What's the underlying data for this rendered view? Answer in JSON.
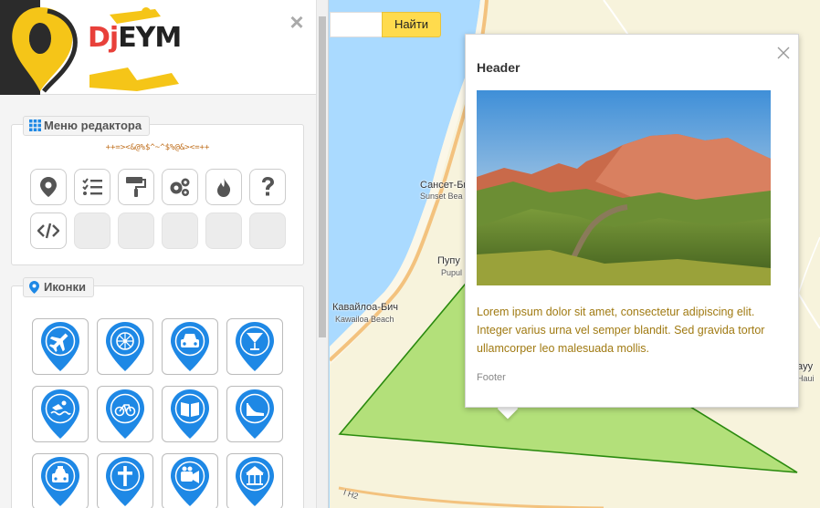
{
  "sidebar": {
    "close_label": "×",
    "logo": {
      "part1": "Dj",
      "part2": "EYM"
    },
    "editor_menu": {
      "title": "Меню редактора",
      "code_line": "++=><&@%$^~^$%@&><=++",
      "tools": [
        {
          "icon": "map-marker-icon"
        },
        {
          "icon": "list-icon"
        },
        {
          "icon": "paint-roller-icon"
        },
        {
          "icon": "gears-icon"
        },
        {
          "icon": "fire-icon"
        },
        {
          "icon": "question-icon"
        },
        {
          "icon": "code-icon"
        }
      ]
    },
    "icons_panel": {
      "title": "Иконки",
      "icons": [
        "airplane-icon",
        "ferris-wheel-icon",
        "car-icon",
        "cocktail-icon",
        "swimming-icon",
        "bicycle-icon",
        "book-icon",
        "high-heel-icon",
        "taxi-icon",
        "church-cross-icon",
        "video-camera-icon",
        "carousel-icon"
      ]
    }
  },
  "map": {
    "search_button": "Найти",
    "labels": [
      {
        "text": "Сансет-Би",
        "sub": "Sunset Bea"
      },
      {
        "text": "Пупу",
        "sub": "Pupul"
      },
      {
        "text": "Кавайлоа-Бич",
        "sub": "Kawailoa Beach"
      },
      {
        "text": "ayy",
        "sub": "Haui"
      },
      {
        "text": "I H2"
      }
    ]
  },
  "balloon": {
    "header": "Header",
    "body": "Lorem ipsum dolor sit amet, consectetur adipiscing elit. Integer varius urna vel semper blandit. Sed gravida tortor ullamcorper leo malesuada mollis.",
    "footer": "Footer"
  },
  "colors": {
    "pin_blue": "#1e88e5",
    "polygon_fill": "#b3e07a",
    "polygon_stroke": "#2a8a0e",
    "search_button": "#ffdb4d",
    "body_text": "#a07a12"
  }
}
